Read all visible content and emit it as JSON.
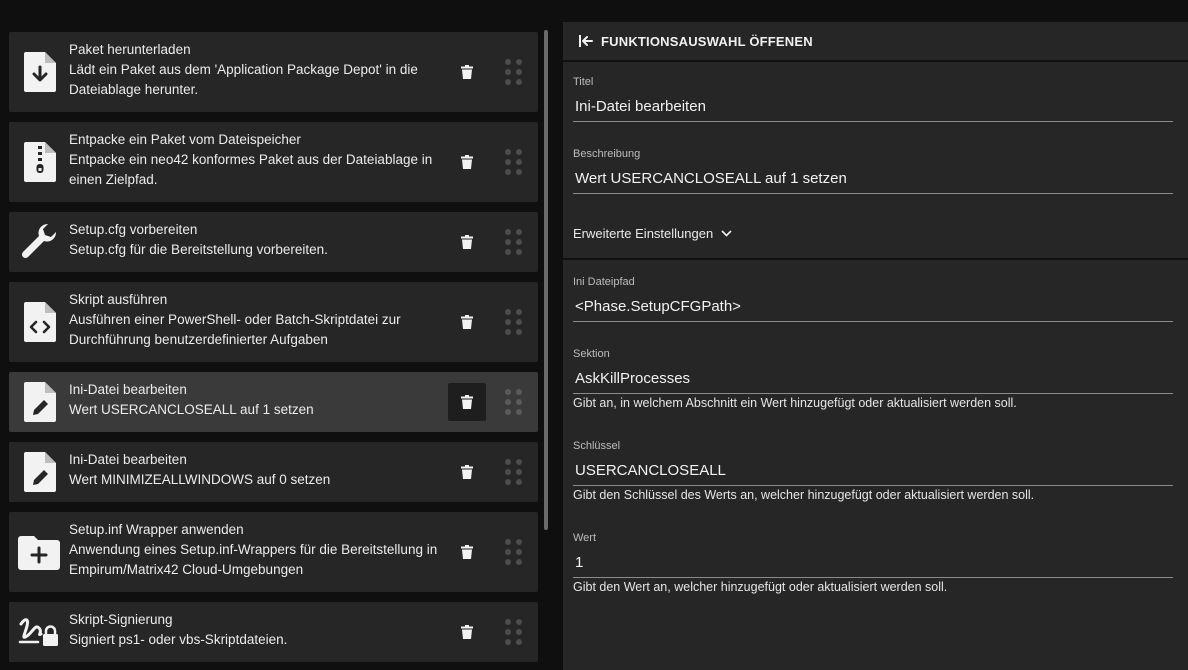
{
  "list": {
    "items": [
      {
        "title": "Paket herunterladen",
        "desc": "Lädt ein Paket aus dem 'Application Package Depot' in die Dateiablage herunter.",
        "icon": "file-download-icon"
      },
      {
        "title": "Entpacke ein Paket vom Dateispeicher",
        "desc": "Entpacke ein neo42 konformes Paket aus der Dateiablage in einen Zielpfad.",
        "icon": "file-zip-icon"
      },
      {
        "title": "Setup.cfg vorbereiten",
        "desc": "Setup.cfg für die Bereitstellung vorbereiten.",
        "icon": "wrench-icon"
      },
      {
        "title": "Skript ausführen",
        "desc": "Ausführen einer PowerShell- oder Batch-Skriptdatei zur Durchführung benutzerdefinierter Aufgaben",
        "icon": "file-code-icon"
      },
      {
        "title": "Ini-Datei bearbeiten",
        "desc": "Wert USERCANCLOSEALL auf 1 setzen",
        "icon": "file-edit-icon",
        "selected": true
      },
      {
        "title": "Ini-Datei bearbeiten",
        "desc": "Wert MINIMIZEALLWINDOWS auf 0 setzen",
        "icon": "file-edit-icon"
      },
      {
        "title": "Setup.inf Wrapper anwenden",
        "desc": "Anwendung eines Setup.inf-Wrappers für die Bereitstellung in Empirum/Matrix42 Cloud-Umgebungen",
        "icon": "folder-plus-icon"
      },
      {
        "title": "Skript-Signierung",
        "desc": "Signiert ps1- oder vbs-Skriptdateien.",
        "icon": "signature-lock-icon"
      }
    ]
  },
  "panel": {
    "header": "FUNKTIONSAUSWAHL ÖFFENEN",
    "title_label": "Titel",
    "title_value": "Ini-Datei bearbeiten",
    "desc_label": "Beschreibung",
    "desc_value": "Wert USERCANCLOSEALL auf 1 setzen",
    "advanced": "Erweiterte Einstellungen",
    "path_label": "Ini Dateipfad",
    "path_value": "<Phase.SetupCFGPath>",
    "section_label": "Sektion",
    "section_value": "AskKillProcesses",
    "section_hint": "Gibt an, in welchem Abschnitt ein Wert hinzugefügt oder aktualisiert werden soll.",
    "key_label": "Schlüssel",
    "key_value": "USERCANCLOSEALL",
    "key_hint": "Gibt den Schlüssel des Werts an, welcher hinzugefügt oder aktualisiert werden soll.",
    "value_label": "Wert",
    "value_value": "1",
    "value_hint": "Gibt den Wert an, welcher hinzugefügt oder aktualisiert werden soll."
  },
  "colors": {
    "background": "#0f0f0f",
    "card": "#262626",
    "card_selected": "#3a3a3a",
    "text": "#ececec"
  }
}
